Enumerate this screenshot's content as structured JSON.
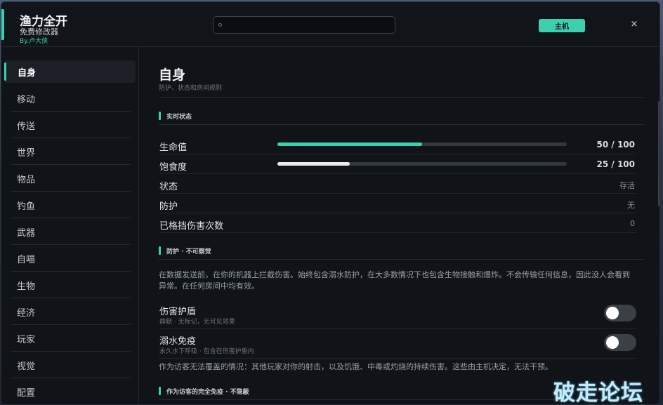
{
  "app": {
    "title": "渔力全开",
    "subtitle": "免费修改器",
    "author": "By.卢大侠",
    "host_label": "主机",
    "close_label": "×",
    "search_placeholder": ""
  },
  "sidebar": {
    "items": [
      {
        "label": "自身",
        "active": true
      },
      {
        "label": "移动"
      },
      {
        "label": "传送"
      },
      {
        "label": "世界"
      },
      {
        "label": "物品"
      },
      {
        "label": "钓鱼"
      },
      {
        "label": "武器"
      },
      {
        "label": "自喵"
      },
      {
        "label": "生物"
      },
      {
        "label": "经济"
      },
      {
        "label": "玩家"
      },
      {
        "label": "视觉"
      },
      {
        "label": "配置"
      }
    ]
  },
  "main": {
    "title": "自身",
    "subtitle": "防护、状态和房间规则",
    "section_status": "实时状态",
    "health": {
      "label": "生命值",
      "value_text": "50 / 100",
      "fraction": 0.5,
      "color": "#3ccfb0"
    },
    "hunger": {
      "label": "饱食度",
      "value_text": "25 / 100",
      "fraction": 0.25,
      "color": "#e8eaed"
    },
    "state": {
      "label": "状态",
      "value": "存活"
    },
    "protection": {
      "label": "防护",
      "value": "无"
    },
    "blocked": {
      "label": "已格挡伤害次数",
      "value": "0"
    },
    "section_protect": "防护 · 不可察觉",
    "protect_desc": "在数据发送前，在你的机器上拦截伤害。始终包含溺水防护，在大多数情况下也包含生物接触和爆炸。不会传输任何信息，因此没人会看到异常。在任何房间中均有效。",
    "damage_shield": {
      "title": "伤害护盾",
      "sub": "静默 · 无标记，无可见效果",
      "on": false
    },
    "drown_immunity": {
      "title": "溺水免疫",
      "sub": "永久水下呼吸 · 包含在伤害护盾内",
      "on": false
    },
    "guest_desc": "作为访客无法覆盖的情况：其他玩家对你的射击，以及饥饿、中毒或灼烧的持续伤害。这些由主机决定，无法干预。",
    "section_guest": "作为访客的完全免疫 · 不隐蔽"
  },
  "watermark": "破走论坛"
}
